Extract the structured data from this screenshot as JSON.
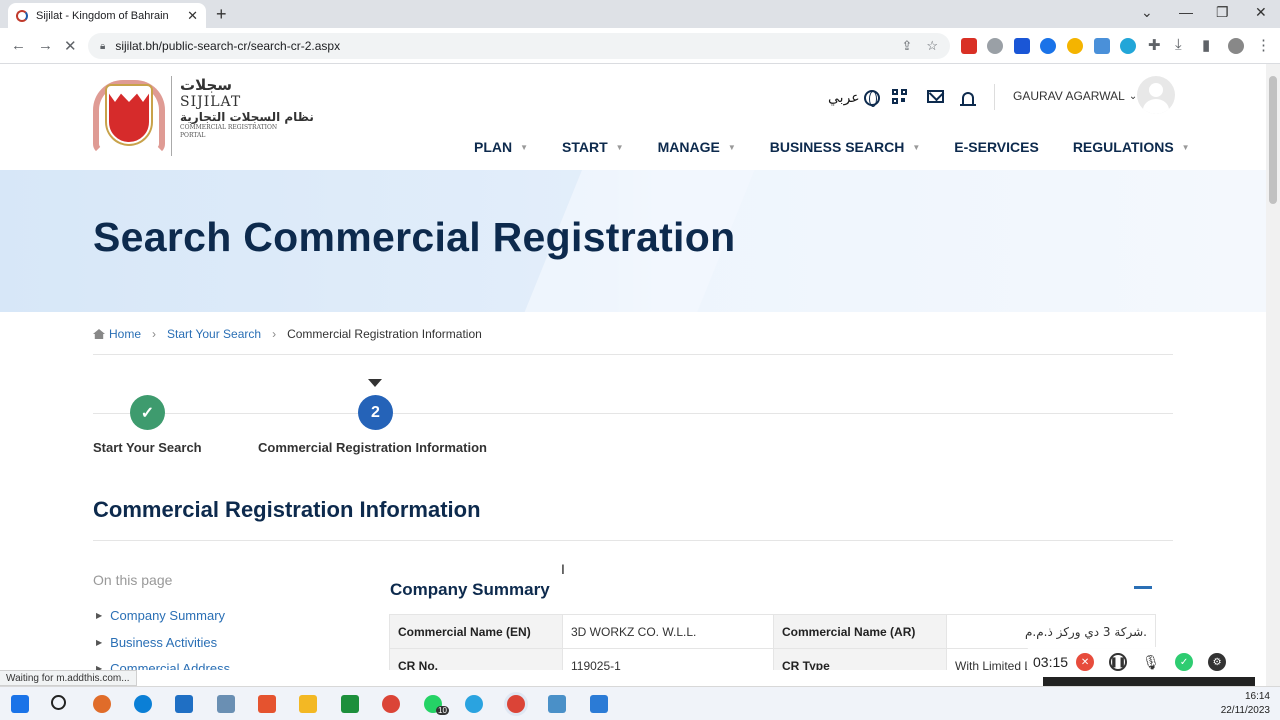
{
  "browser": {
    "tab_title": "Sijilat - Kingdom of Bahrain",
    "tab_close": "✕",
    "new_tab": "+",
    "url": "sijilat.bh/public-search-cr/search-cr-2.aspx",
    "status_text": "Waiting for m.addthis.com..."
  },
  "header": {
    "logo": {
      "arabic_top": "سجلات",
      "english": "SIJILAT",
      "arabic_bottom": "نظام السجلات التجارية",
      "subtitle_line1": "COMMERCIAL REGISTRATION",
      "subtitle_line2": "PORTAL"
    },
    "language_label": "عربي",
    "user_name": "GAURAV AGARWAL"
  },
  "nav": {
    "items": [
      {
        "label": "PLAN",
        "has_dropdown": true
      },
      {
        "label": "START",
        "has_dropdown": true
      },
      {
        "label": "MANAGE",
        "has_dropdown": true
      },
      {
        "label": "BUSINESS SEARCH",
        "has_dropdown": true
      },
      {
        "label": "E-SERVICES",
        "has_dropdown": false
      },
      {
        "label": "REGULATIONS",
        "has_dropdown": true
      }
    ]
  },
  "hero": {
    "title": "Search Commercial Registration"
  },
  "breadcrumb": {
    "items": [
      "Home",
      "Start Your Search",
      "Commercial Registration Information"
    ]
  },
  "steps": {
    "items": [
      {
        "label": "Start Your Search",
        "status": "complete",
        "marker": "✓"
      },
      {
        "label": "Commercial Registration Information",
        "status": "current",
        "marker": "2"
      }
    ]
  },
  "section": {
    "title": "Commercial Registration Information"
  },
  "sidebar": {
    "heading": "On this page",
    "links": [
      "Company Summary",
      "Business Activities",
      "Commercial Address"
    ]
  },
  "summary": {
    "title": "Company Summary",
    "rows": [
      {
        "label1": "Commercial Name (EN)",
        "value1": "3D WORKZ CO. W.L.L.",
        "label2": "Commercial Name (AR)",
        "value2": "شركة 3 دي وركز ذ.م.م."
      },
      {
        "label1": "CR No.",
        "value1": "119025-1",
        "label2": "CR Type",
        "value2": "With Limited L"
      }
    ]
  },
  "recorder": {
    "time": "03:15"
  },
  "taskbar": {
    "time": "16:14",
    "date": "22/11/2023",
    "badge_whatsapp": "10"
  },
  "colors": {
    "navy": "#0d2a4d",
    "link": "#2a6fb5",
    "step_done": "#3e9b6e",
    "step_current": "#2563b8"
  }
}
